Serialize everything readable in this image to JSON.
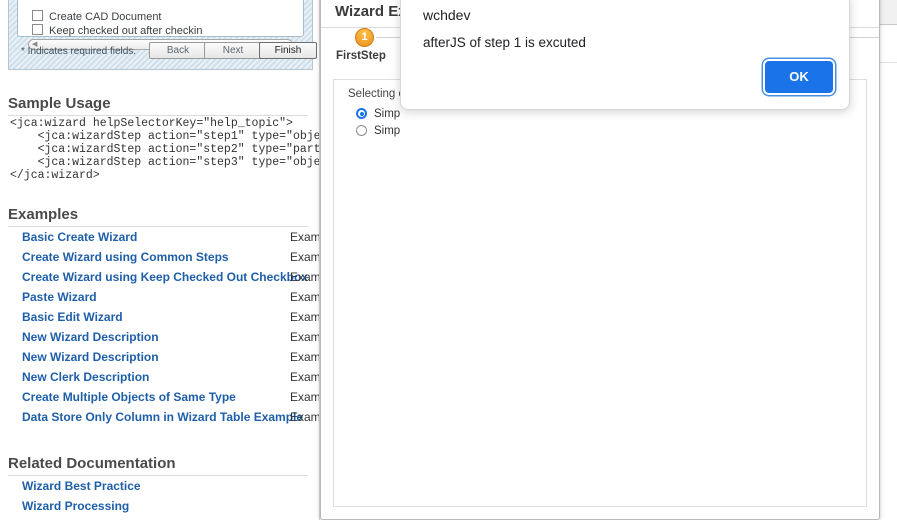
{
  "doc": {
    "screenshot": {
      "checkboxes": [
        "Create CAD Document",
        "Keep checked out after checkin"
      ],
      "scroll_hint": "...",
      "required_note": "* Indicates required fields.",
      "buttons": [
        "Back",
        "Next",
        "Finish"
      ]
    },
    "sample_usage": {
      "heading": "Sample Usage",
      "code": "<jca:wizard helpSelectorKey=\"help_topic\">\n    <jca:wizardStep action=\"step1\" type=\"object\"/>\n    <jca:wizardStep action=\"step2\" type=\"part\"/>\n    <jca:wizardStep action=\"step3\" type=\"object\"/>\n</jca:wizard>"
    },
    "examples": {
      "heading": "Examples",
      "items": [
        {
          "label": "Basic Create Wizard",
          "desc": "Examp"
        },
        {
          "label": "Create Wizard using Common Steps",
          "desc": "Examp"
        },
        {
          "label": "Create Wizard using Keep Checked Out Checkbox",
          "desc": "Examp"
        },
        {
          "label": "Paste Wizard",
          "desc": "Examp"
        },
        {
          "label": "Basic Edit Wizard",
          "desc": "Examp"
        },
        {
          "label": "New Wizard Description",
          "desc": "Examp"
        },
        {
          "label": "New Wizard Description",
          "desc": "Examp"
        },
        {
          "label": "New Clerk Description",
          "desc": "Examp"
        },
        {
          "label": "Create Multiple Objects of Same Type",
          "desc": "Examp"
        },
        {
          "label": "Data Store Only Column in Wizard Table Example",
          "desc": "Examp"
        }
      ]
    },
    "related": {
      "heading": "Related Documentation",
      "items": [
        "Wizard Best Practice",
        "Wizard Processing"
      ]
    }
  },
  "wizard": {
    "title": "Wizard Exa",
    "step": {
      "number": "1",
      "label": "FirstStep"
    },
    "legend": "Selecting o",
    "options": [
      {
        "label": "Simp",
        "selected": true
      },
      {
        "label": "Simp",
        "selected": false
      }
    ]
  },
  "alert": {
    "origin": "wchdev",
    "message": "afterJS of step 1 is excuted",
    "ok_label": "OK"
  },
  "colors": {
    "link": "#1f5fa9",
    "accent": "#1a73e8",
    "step": "#e8901b"
  }
}
